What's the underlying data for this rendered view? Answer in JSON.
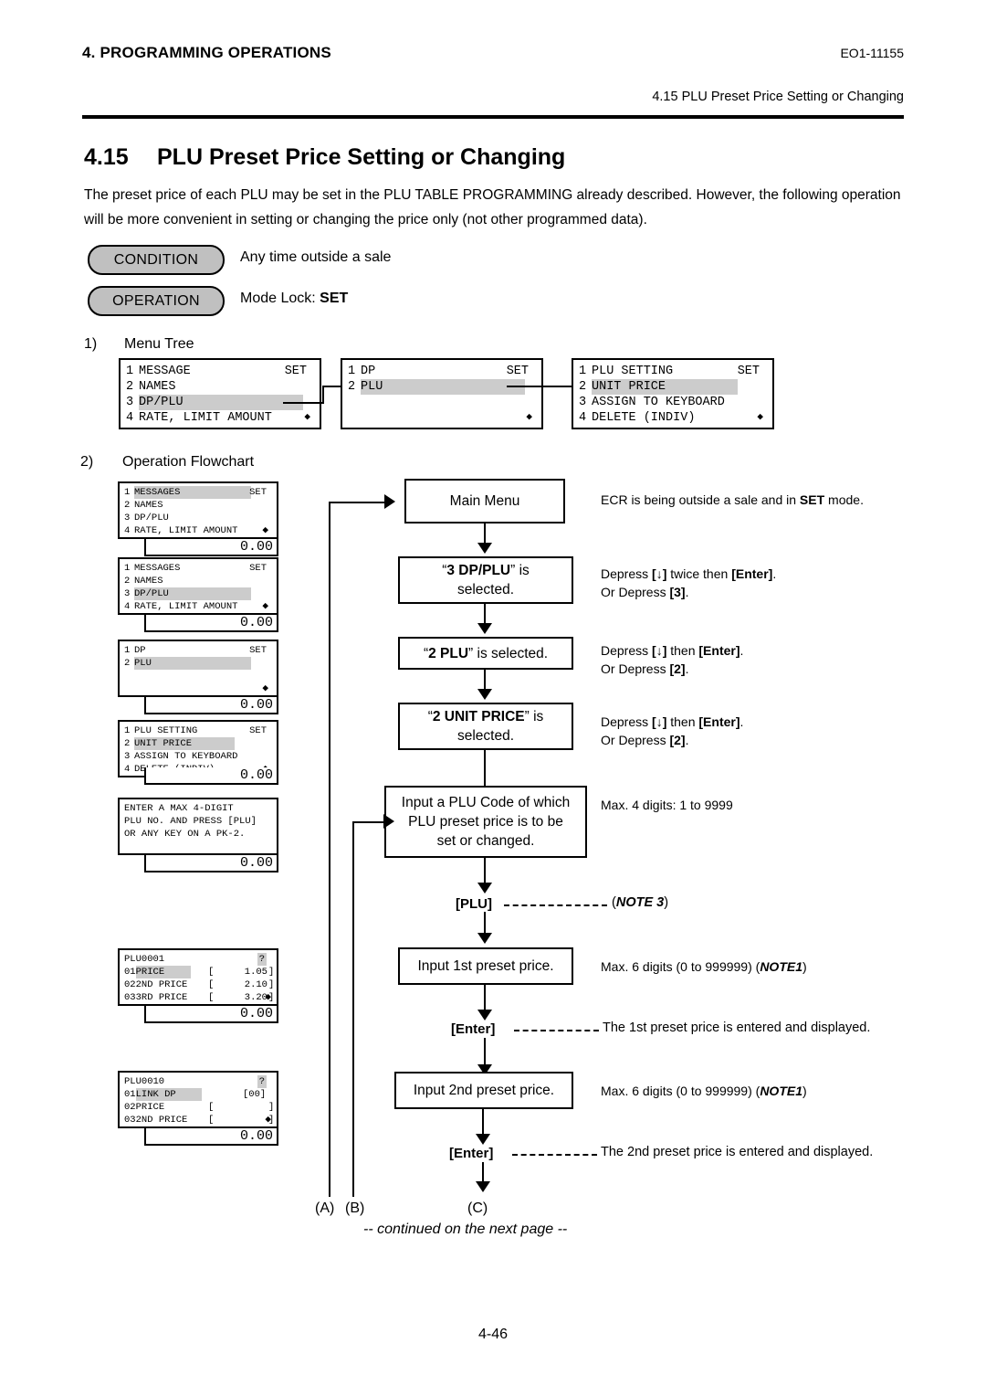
{
  "header": {
    "chapter": "4. PROGRAMMING OPERATIONS",
    "doc_code": "EO1-11155",
    "running_head": "4.15 PLU Preset Price Setting or Changing"
  },
  "section": {
    "number": "4.15",
    "title": "PLU Preset Price Setting or Changing",
    "intro": "The preset price of each PLU may be set in the PLU TABLE PROGRAMMING already described.  However, the following operation will be more convenient in setting or changing the price only (not other programmed data)."
  },
  "pills": {
    "condition_label": "CONDITION",
    "condition_text": "Any time outside a sale",
    "operation_label": "OPERATION",
    "operation_text_prefix": "Mode Lock: ",
    "operation_text_bold": "SET"
  },
  "steps": {
    "one_num": "1)",
    "one_title": "Menu Tree",
    "two_num": "2)",
    "two_title": "Operation Flowchart"
  },
  "menu_tree": [
    {
      "name": "menu-tree-lcd-1",
      "set_label": "SET",
      "rows": [
        {
          "num": "1",
          "label": "MESSAGE",
          "highlight": false
        },
        {
          "num": "2",
          "label": "NAMES",
          "highlight": false
        },
        {
          "num": "3",
          "label": "DP/PLU",
          "highlight": true
        },
        {
          "num": "4",
          "label": "RATE, LIMIT AMOUNT",
          "highlight": false
        }
      ]
    },
    {
      "name": "menu-tree-lcd-2",
      "set_label": "SET",
      "rows": [
        {
          "num": "1",
          "label": "DP",
          "highlight": false
        },
        {
          "num": "2",
          "label": "PLU",
          "highlight": true
        },
        {
          "num": "",
          "label": "",
          "highlight": false
        },
        {
          "num": "",
          "label": "",
          "highlight": false
        }
      ]
    },
    {
      "name": "menu-tree-lcd-3",
      "set_label": "SET",
      "rows": [
        {
          "num": "1",
          "label": "PLU SETTING",
          "highlight": false
        },
        {
          "num": "2",
          "label": "UNIT PRICE",
          "highlight": true
        },
        {
          "num": "3",
          "label": "ASSIGN TO KEYBOARD",
          "highlight": false
        },
        {
          "num": "4",
          "label": "DELETE (INDIV)",
          "highlight": false
        }
      ]
    }
  ],
  "flow_lcds": [
    {
      "set_label": "SET",
      "amount": "0.00",
      "rows": [
        {
          "num": "1",
          "label": "MESSAGES",
          "highlight": true
        },
        {
          "num": "2",
          "label": "NAMES",
          "highlight": false
        },
        {
          "num": "3",
          "label": "DP/PLU",
          "highlight": false
        },
        {
          "num": "4",
          "label": "RATE, LIMIT AMOUNT",
          "highlight": false
        }
      ]
    },
    {
      "set_label": "SET",
      "amount": "0.00",
      "rows": [
        {
          "num": "1",
          "label": "MESSAGES",
          "highlight": false
        },
        {
          "num": "2",
          "label": "NAMES",
          "highlight": false
        },
        {
          "num": "3",
          "label": "DP/PLU",
          "highlight": true
        },
        {
          "num": "4",
          "label": "RATE, LIMIT AMOUNT",
          "highlight": false
        }
      ]
    },
    {
      "set_label": "SET",
      "amount": "0.00",
      "rows": [
        {
          "num": "1",
          "label": "DP",
          "highlight": false
        },
        {
          "num": "2",
          "label": "PLU",
          "highlight": true
        },
        {
          "num": "",
          "label": "",
          "highlight": false
        },
        {
          "num": "",
          "label": "",
          "highlight": false
        }
      ]
    },
    {
      "set_label": "SET",
      "amount": "0.00",
      "rows": [
        {
          "num": "1",
          "label": "PLU SETTING",
          "highlight": false
        },
        {
          "num": "2",
          "label": "UNIT PRICE",
          "highlight": true
        },
        {
          "num": "3",
          "label": "ASSIGN TO KEYBOARD",
          "highlight": false
        },
        {
          "num": "4",
          "label": "DELETE (INDIV)",
          "highlight": false
        }
      ]
    }
  ],
  "prompt_lcd": {
    "amount": "0.00",
    "line1": "ENTER A MAX 4-DIGIT",
    "line2": "PLU NO. AND PRESS [PLU]",
    "line3": "OR ANY KEY ON A PK-2."
  },
  "plu_lcd_1": {
    "title": "PLU0001",
    "help": "?",
    "amount": "0.00",
    "rows": [
      {
        "num": "01",
        "label": "PRICE",
        "bracket_open": "[",
        "value": "1.05",
        "bracket_close": "]",
        "highlight": true
      },
      {
        "num": "02",
        "label": "2ND PRICE",
        "bracket_open": "[",
        "value": "2.10",
        "bracket_close": "]",
        "highlight": false
      },
      {
        "num": "03",
        "label": "3RD PRICE",
        "bracket_open": "[",
        "value": "3.20",
        "bracket_close": "]",
        "highlight": false
      }
    ]
  },
  "plu_lcd_2": {
    "title": "PLU0010",
    "help": "?",
    "amount": "0.00",
    "rows": [
      {
        "num": "01",
        "label": "LINK DP",
        "bracket_open": "",
        "value": "[00]",
        "bracket_close": "",
        "highlight": true
      },
      {
        "num": "02",
        "label": "PRICE",
        "bracket_open": "[",
        "value": "",
        "bracket_close": "]",
        "highlight": false
      },
      {
        "num": "03",
        "label": "2ND PRICE",
        "bracket_open": "[",
        "value": "",
        "bracket_close": "]",
        "highlight": false
      }
    ]
  },
  "flow": {
    "box_main_menu": "Main Menu",
    "note_main_menu_a": "ECR is being outside a sale and in ",
    "note_main_menu_b": "SET",
    "note_main_menu_c": " mode.",
    "box_dpplu_q1": "“",
    "box_dpplu_bold": "3 DP/PLU",
    "box_dpplu_q2": "” is",
    "box_dpplu_line2": "selected.",
    "note_dpplu_1a": "Depress ",
    "note_dpplu_1b": "[↓]",
    "note_dpplu_1c": " twice then ",
    "note_dpplu_1d": "[Enter]",
    "note_dpplu_1e": ".",
    "note_dpplu_2a": "Or Depress ",
    "note_dpplu_2b": "[3]",
    "note_dpplu_2c": ".",
    "box_plu_q1": "“",
    "box_plu_bold": "2 PLU",
    "box_plu_q2": "” is selected.",
    "note_plu_1a": "Depress ",
    "note_plu_1b": "[↓]",
    "note_plu_1c": " then ",
    "note_plu_1d": "[Enter]",
    "note_plu_1e": ".",
    "note_plu_2a": "Or Depress ",
    "note_plu_2b": "[2]",
    "note_plu_2c": ".",
    "box_unit_q1": "“",
    "box_unit_bold": "2 UNIT PRICE",
    "box_unit_q2": "” is",
    "box_unit_line2": "selected.",
    "note_unit_1a": "Depress ",
    "note_unit_1b": "[↓]",
    "note_unit_1c": " then ",
    "note_unit_1d": "[Enter]",
    "note_unit_1e": ".",
    "note_unit_2a": "Or Depress ",
    "note_unit_2b": "[2]",
    "note_unit_2c": ".",
    "box_code_l1": "Input a PLU Code of which",
    "box_code_l2": "PLU preset price is to be",
    "box_code_l3": "set or changed.",
    "note_code": "Max. 4 digits: 1 to 9999",
    "key_plu": "[PLU]",
    "key_plu_note_open": "(",
    "key_plu_note_italic": "NOTE 3",
    "key_plu_note_close": ")",
    "box_price1": "Input 1st preset price.",
    "note_price1_a": "Max. 6 digits (0 to 999999) (",
    "note_price1_b": "NOTE1",
    "note_price1_c": ")",
    "key_enter1": "[Enter]",
    "note_enter1": "The 1st preset price is entered and displayed.",
    "box_price2": "Input 2nd preset price.",
    "note_price2_a": "Max. 6 digits (0 to 999999) (",
    "note_price2_b": "NOTE1",
    "note_price2_c": ")",
    "key_enter2": "[Enter]",
    "note_enter2": "The 2nd preset price is entered and displayed.",
    "label_a": "(A)",
    "label_b": "(B)",
    "label_c": "(C)",
    "continued": "-- continued on the next page  --"
  },
  "footer": {
    "page_number": "4-46"
  }
}
